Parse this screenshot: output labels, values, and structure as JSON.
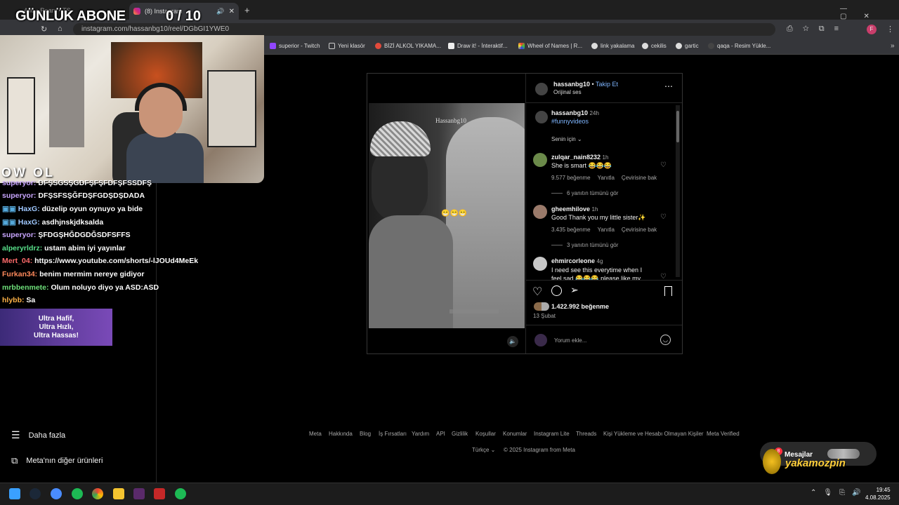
{
  "browser": {
    "tab_inactive_label": "Alle • Ream • TS",
    "tab_active_label": "(8) Instagram",
    "tooltip": "(8) Instagram",
    "url": "instagram.com/hassanbg10/reel/DGbGI1YWE0",
    "bookmarks": [
      "superior - Twitch",
      "Yeni klasör",
      "BİZİ ALKOL YIKAMA...",
      "Draw it! - İnteraktif...",
      "Wheel of Names | R...",
      "link yakalama",
      "cekilis",
      "gartic",
      "qaqa - Resim Yükle..."
    ]
  },
  "post": {
    "username": "hassanbg10",
    "follow": "Takip Et",
    "audio": "Orijinal ses",
    "watermark": "Hassanbg10",
    "emoji_overlay": "😁😁😁",
    "caption_user": "hassanbg10",
    "caption_time": "24h",
    "caption_tag": "#funnyvideos",
    "for_you": "Senin için",
    "comments": [
      {
        "user": "zulqar_nain8232",
        "time": "1h",
        "text": "She is smart 😂😂😂",
        "likes": "9.577 beğenme",
        "reply": "Yanıtla",
        "translate": "Çevirisine bak",
        "more": "6 yanıtın tümünü gör"
      },
      {
        "user": "gheemhilove",
        "time": "1h",
        "text": "Good Thank you my little sister✨",
        "likes": "3.435 beğenme",
        "reply": "Yanıtla",
        "translate": "Çevirisine bak",
        "more": "3 yanıtın tümünü gör"
      },
      {
        "user": "ehmircorleone",
        "time": "4g",
        "text": "I need see this everytime when I feel sad 😂😂😂 please like my"
      }
    ],
    "like_count": "1.422.992 beğenme",
    "date": "13 Şubat",
    "comment_placeholder": "Yorum ekle..."
  },
  "stream": {
    "title": "GÜNLÜK ABONE",
    "counter": "0 / 10",
    "logo_text": "OW OL",
    "chat": [
      {
        "user": "superyor:",
        "msg": "DFŞSGSŞGDFŞFŞFDFŞFSSDFŞ",
        "color": "#c9a6ff"
      },
      {
        "user": "superyor:",
        "msg": "DFŞSFSŞĞFDŞFGDŞDŞDADA",
        "color": "#c9a6ff"
      },
      {
        "user": "HaxG:",
        "msg": "düzelip oyun oynuyo ya bide",
        "color": "#9fc8ff"
      },
      {
        "user": "HaxG:",
        "msg": "asdhjnskjdksalda",
        "color": "#9fc8ff"
      },
      {
        "user": "superyor:",
        "msg": "ŞFDGŞHĞDGDĞSDFSFFS",
        "color": "#c9a6ff"
      },
      {
        "user": "alperyrldrz:",
        "msg": "ustam abim iyi yayınlar",
        "color": "#58e08a"
      },
      {
        "user": "Mert_04:",
        "msg": "https://www.youtube.com/shorts/-lJOUd4MeEk",
        "color": "#ff6b6b"
      },
      {
        "user": "Furkan34:",
        "msg": "benim mermim nereye gidiyor",
        "color": "#ff8a5c"
      },
      {
        "user": "mrbbenmete:",
        "msg": "Olum noluyo diyo ya ASD:ASD",
        "color": "#6ee07a"
      },
      {
        "user": "hlybb:",
        "msg": "Sa",
        "color": "#ffb347"
      }
    ],
    "promo": [
      "Ultra Hafif,",
      "Ultra Hızlı,",
      "Ultra Hassas!"
    ],
    "messages_label": "Mesajlar",
    "messages_badge": "8",
    "brand": "yakamozpin"
  },
  "left_menu": {
    "more": "Daha fazla",
    "meta_products": "Meta'nın diğer ürünleri"
  },
  "footer": {
    "links": [
      "Meta",
      "Hakkında",
      "Blog",
      "İş Fırsatları",
      "Yardım",
      "API",
      "Gizlilik",
      "Koşullar",
      "Konumlar",
      "Instagram Lite",
      "Threads",
      "Kişi Yükleme ve Hesabı Olmayan Kişiler",
      "Meta Verified"
    ],
    "language": "Türkçe",
    "copyright": "© 2025 Instagram from Meta"
  },
  "taskbar": {
    "time": "19:45",
    "date": "4.08.2025"
  }
}
